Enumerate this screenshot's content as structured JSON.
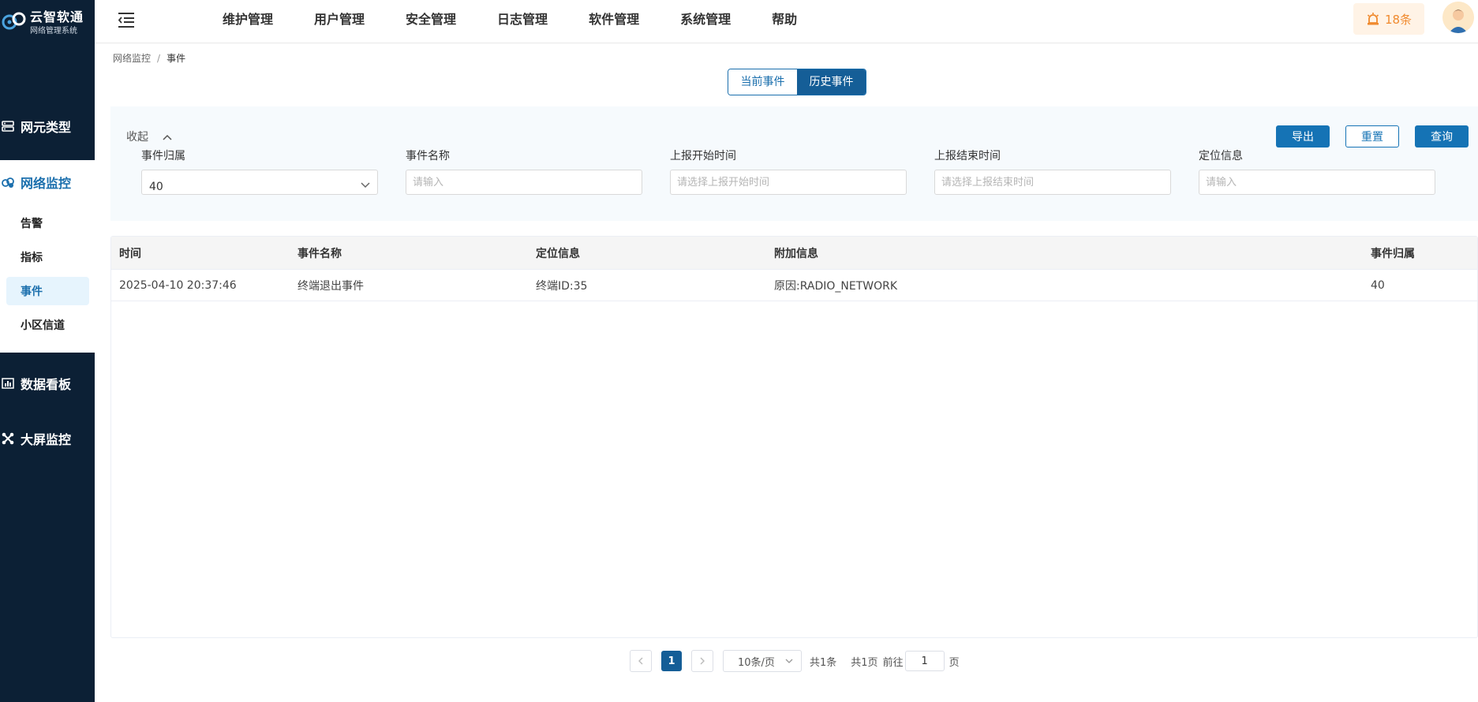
{
  "brand": {
    "title": "云智软通",
    "subtitle": "网络管理系统"
  },
  "sidebar": {
    "groups": [
      {
        "label": "网元类型",
        "icon": "server-icon"
      },
      {
        "label": "网络监控",
        "icon": "network-monitor-icon"
      },
      {
        "label": "数据看板",
        "icon": "bar-chart-icon"
      },
      {
        "label": "大屏监控",
        "icon": "big-screen-icon"
      }
    ],
    "subitems": [
      {
        "label": "告警"
      },
      {
        "label": "指标"
      },
      {
        "label": "事件",
        "active": true
      },
      {
        "label": "小区信道"
      }
    ]
  },
  "topnav": [
    "维护管理",
    "用户管理",
    "安全管理",
    "日志管理",
    "软件管理",
    "系统管理",
    "帮助"
  ],
  "alarm": {
    "count_label": "18条",
    "color": "#f08a2e"
  },
  "breadcrumb": {
    "parent": "网络监控",
    "separator": "/",
    "current": "事件"
  },
  "tabs": {
    "current": "当前事件",
    "history": "历史事件",
    "active": "history"
  },
  "filter": {
    "collapse_label": "收起",
    "buttons": {
      "export": "导出",
      "reset": "重置",
      "query": "查询"
    },
    "fields": [
      {
        "label": "事件归属",
        "value": "40",
        "type": "select"
      },
      {
        "label": "事件名称",
        "placeholder": "请输入"
      },
      {
        "label": "上报开始时间",
        "placeholder": "请选择上报开始时间"
      },
      {
        "label": "上报结束时间",
        "placeholder": "请选择上报结束时间"
      },
      {
        "label": "定位信息",
        "placeholder": "请输入"
      }
    ]
  },
  "table": {
    "headers": [
      "时间",
      "事件名称",
      "定位信息",
      "附加信息",
      "事件归属"
    ],
    "rows": [
      [
        "2025-04-10 20:37:46",
        "终端退出事件",
        "终端ID:35",
        "原因:RADIO_NETWORK",
        "40"
      ]
    ]
  },
  "pagination": {
    "current_page": "1",
    "page_size": "10条/页",
    "total_items": "共1条",
    "total_pages": "共1页",
    "goto_label": "前往",
    "goto_value": "1",
    "page_suffix": "页"
  },
  "colors": {
    "sidebar_bg": "#0c2035",
    "primary": "#1573b5",
    "active_tab": "#155e97"
  }
}
